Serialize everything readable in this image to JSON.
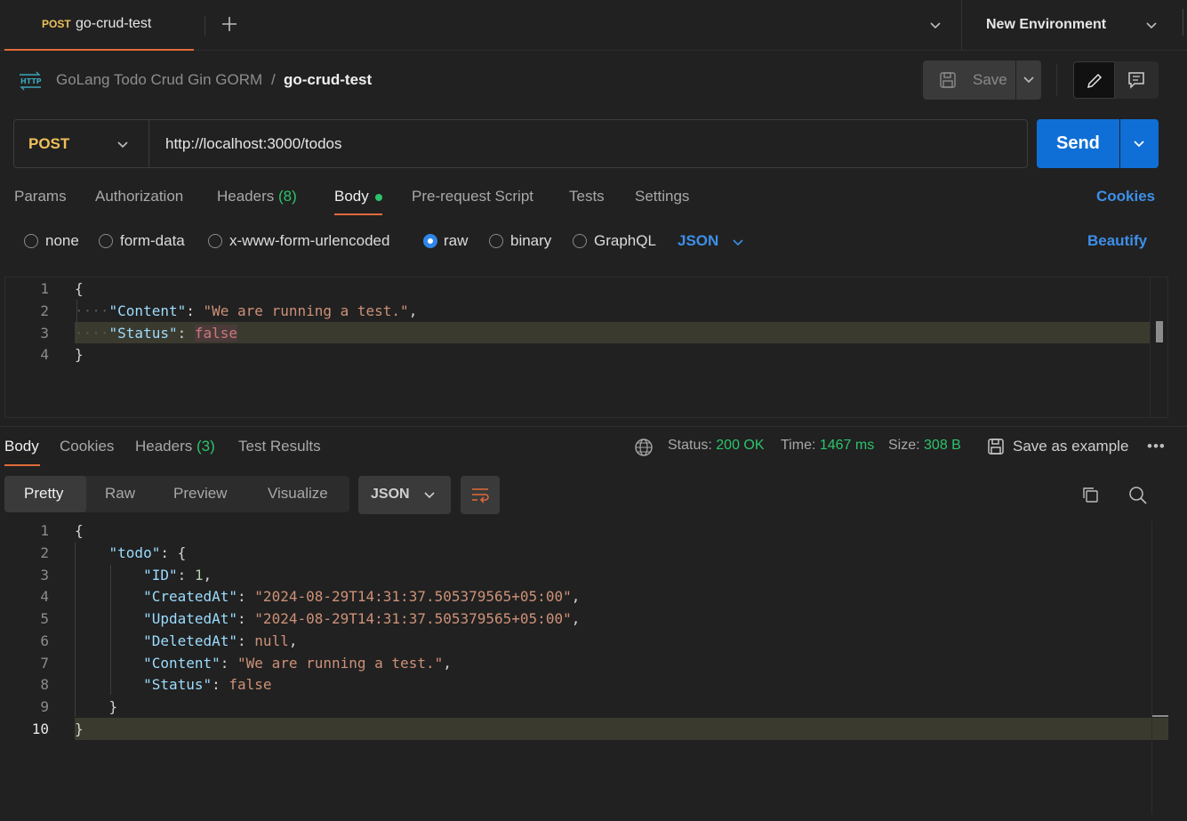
{
  "tab": {
    "method": "POST",
    "name": "go-crud-test"
  },
  "environment": {
    "name": "New Environment"
  },
  "breadcrumb": {
    "icon": "HTTP",
    "collection": "GoLang Todo Crud Gin GORM",
    "separator": "/",
    "request": "go-crud-test"
  },
  "toolbar": {
    "save_label": "Save"
  },
  "request": {
    "method": "POST",
    "url": "http://localhost:3000/todos",
    "send_label": "Send"
  },
  "request_tabs": {
    "params": "Params",
    "authorization": "Authorization",
    "headers": "Headers",
    "headers_count": "(8)",
    "body": "Body",
    "prerequest": "Pre-request Script",
    "tests": "Tests",
    "settings": "Settings",
    "cookies": "Cookies"
  },
  "body_types": {
    "none": "none",
    "form_data": "form-data",
    "urlencoded": "x-www-form-urlencoded",
    "raw": "raw",
    "binary": "binary",
    "graphql": "GraphQL",
    "selected": "raw",
    "format": "JSON",
    "beautify": "Beautify"
  },
  "request_body": {
    "line_numbers": [
      "1",
      "2",
      "3",
      "4"
    ],
    "open_brace": "{",
    "content_key": "\"Content\"",
    "content_value": "\"We are running a test.\"",
    "status_key": "\"Status\"",
    "status_value": "false",
    "close_brace": "}"
  },
  "response_tabs": {
    "body": "Body",
    "cookies": "Cookies",
    "headers": "Headers",
    "headers_count": "(3)",
    "test_results": "Test Results"
  },
  "response_meta": {
    "status_label": "Status:",
    "status_value": "200 OK",
    "time_label": "Time:",
    "time_value": "1467 ms",
    "size_label": "Size:",
    "size_value": "308 B",
    "save_example": "Save as example",
    "more": "•••"
  },
  "view_modes": {
    "pretty": "Pretty",
    "raw": "Raw",
    "preview": "Preview",
    "visualize": "Visualize",
    "format": "JSON"
  },
  "response_body": {
    "line_numbers": [
      "1",
      "2",
      "3",
      "4",
      "5",
      "6",
      "7",
      "8",
      "9",
      "10"
    ],
    "open_brace": "{",
    "todo_key": "\"todo\"",
    "id_key": "\"ID\"",
    "id_value": "1",
    "created_key": "\"CreatedAt\"",
    "created_value": "\"2024-08-29T14:31:37.505379565+05:00\"",
    "updated_key": "\"UpdatedAt\"",
    "updated_value": "\"2024-08-29T14:31:37.505379565+05:00\"",
    "deleted_key": "\"DeletedAt\"",
    "deleted_value": "null",
    "content_key": "\"Content\"",
    "content_value": "\"We are running a test.\"",
    "status_key": "\"Status\"",
    "status_value": "false",
    "inner_close": "}",
    "close_brace": "}"
  },
  "colors": {
    "accent": "#e06b3a",
    "send": "#0f6fd6",
    "method": "#f0c05a",
    "success": "#2cc36b",
    "link": "#3d8fe8"
  }
}
